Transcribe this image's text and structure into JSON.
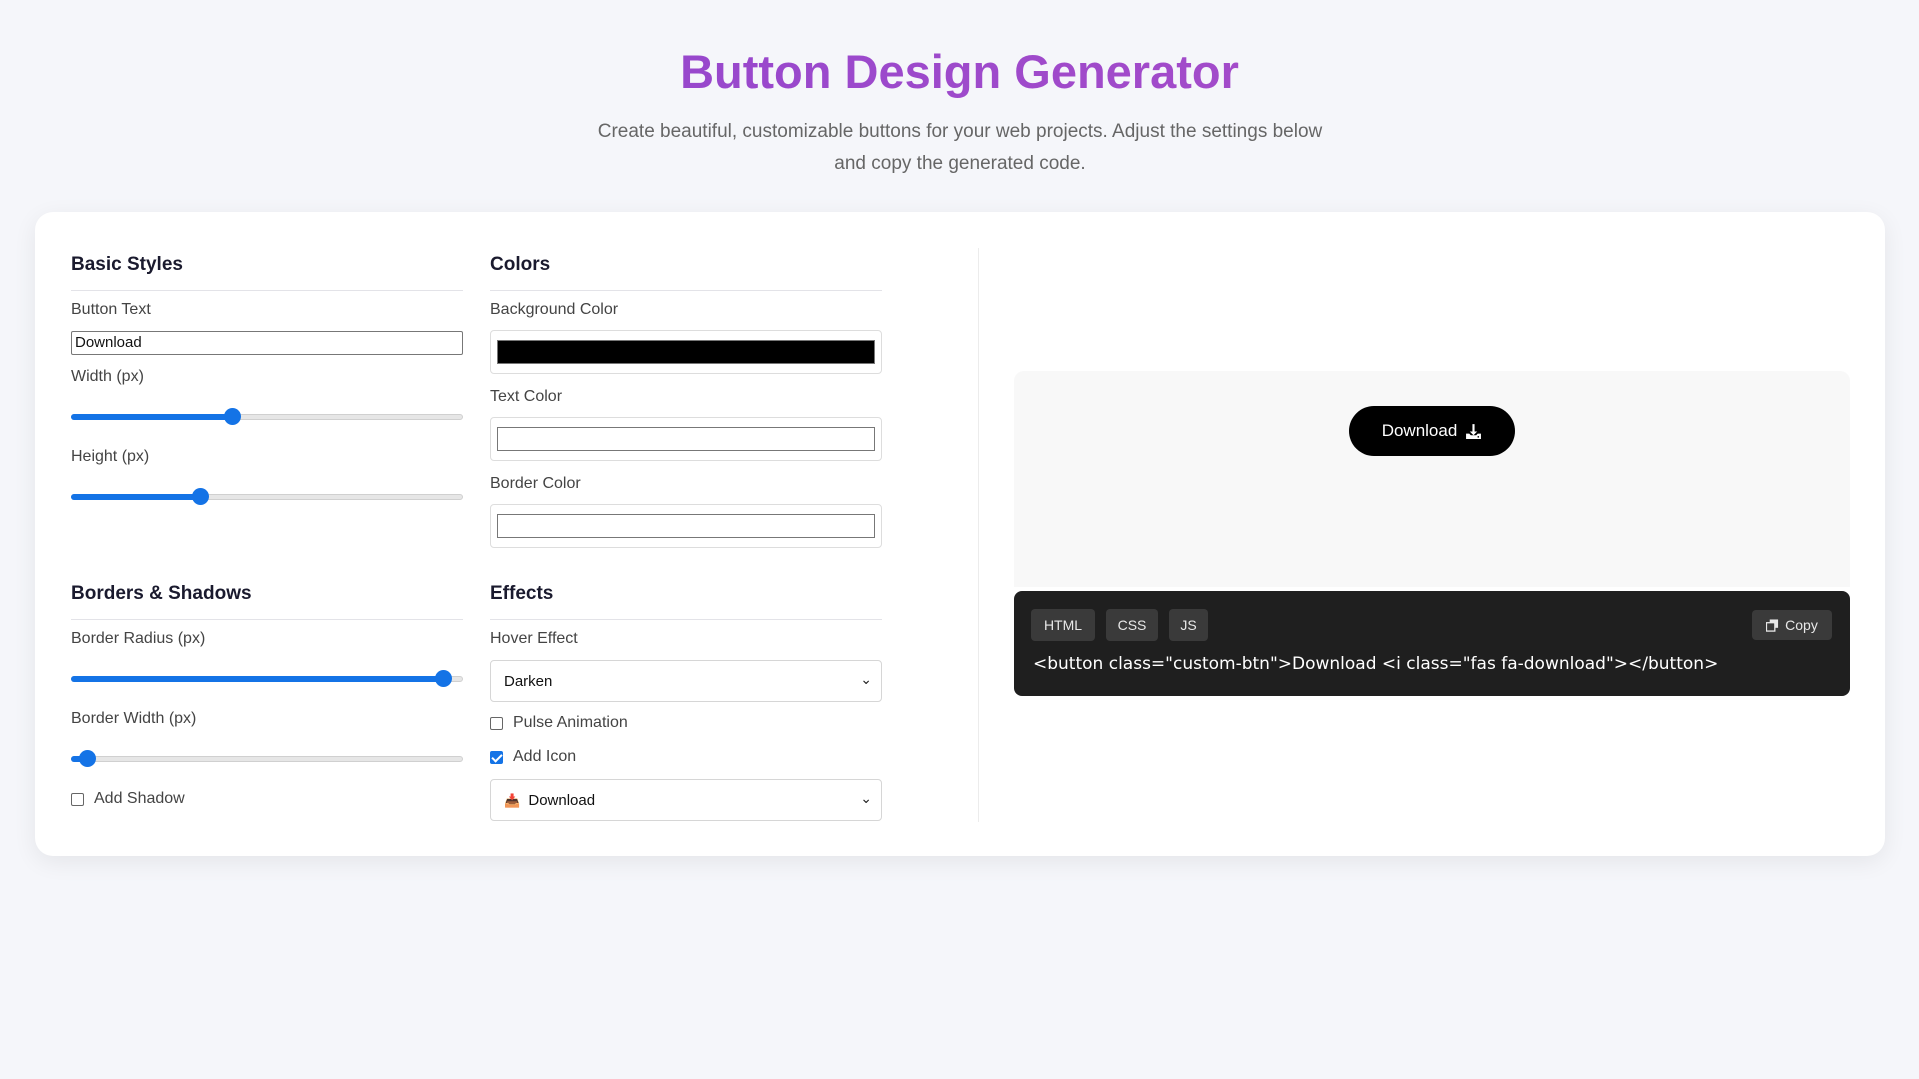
{
  "header": {
    "title": "Button Design Generator",
    "subtitle": "Create beautiful, customizable buttons for your web projects. Adjust the settings below and copy the generated code."
  },
  "basic_styles": {
    "title": "Basic Styles",
    "button_text_label": "Button Text",
    "button_text_value": "Download",
    "width_label": "Width (px)",
    "width_fraction": 0.41,
    "height_label": "Height (px)",
    "height_fraction": 0.33
  },
  "colors": {
    "title": "Colors",
    "background_label": "Background Color",
    "background_value": "#000000",
    "text_label": "Text Color",
    "text_value": "#ffffff",
    "border_label": "Border Color",
    "border_value": "#ffffff"
  },
  "borders": {
    "title": "Borders & Shadows",
    "radius_label": "Border Radius (px)",
    "radius_fraction": 0.95,
    "width_label": "Border Width (px)",
    "width_fraction": 0.04,
    "shadow_label": "Add Shadow",
    "shadow_checked": false
  },
  "effects": {
    "title": "Effects",
    "hover_label": "Hover Effect",
    "hover_value": "Darken",
    "pulse_label": "Pulse Animation",
    "pulse_checked": false,
    "icon_label": "Add Icon",
    "icon_checked": true,
    "icon_value": "Download",
    "icon_glyph": "📥"
  },
  "preview": {
    "button_label": "Download",
    "icon": "download-icon"
  },
  "code": {
    "tabs": [
      "HTML",
      "CSS",
      "JS"
    ],
    "copy_label": "Copy",
    "content": "<button class=\"custom-btn\">Download <i class=\"fas fa-download\"></button>"
  },
  "colors_accent": {
    "slider": "#1473e6",
    "title_gradient_start": "#8b44d0",
    "title_gradient_end": "#b04fc6"
  }
}
